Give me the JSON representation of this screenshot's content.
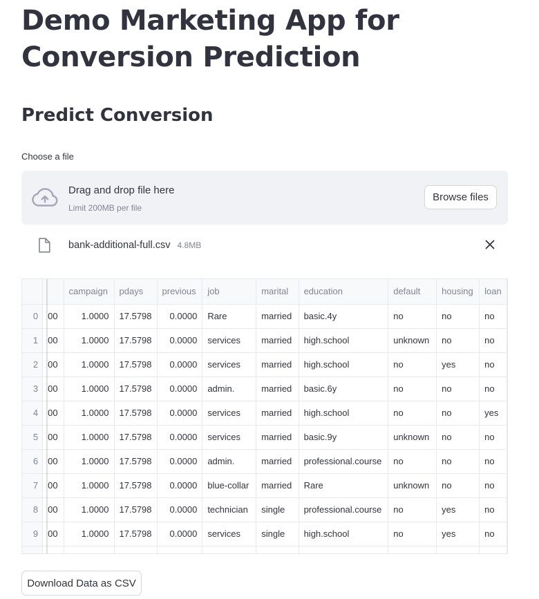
{
  "page": {
    "title": "Demo Marketing App for Conversion Prediction",
    "section_title": "Predict Conversion"
  },
  "uploader": {
    "label": "Choose a file",
    "drag_text": "Drag and drop file here",
    "limit_text": "Limit 200MB per file",
    "browse_label": "Browse files",
    "icon": "cloud-upload-icon"
  },
  "uploaded_file": {
    "name": "bank-additional-full.csv",
    "size": "4.8MB",
    "icon": "file-icon",
    "remove_icon": "close-icon"
  },
  "dataframe": {
    "columns": [
      "campaign",
      "pdays",
      "previous",
      "job",
      "marital",
      "education",
      "default",
      "housing",
      "loan"
    ],
    "rows": [
      {
        "index": "0",
        "cut": "00",
        "cells": [
          "1.0000",
          "17.5798",
          "0.0000",
          "Rare",
          "married",
          "basic.4y",
          "no",
          "no",
          "no"
        ]
      },
      {
        "index": "1",
        "cut": "00",
        "cells": [
          "1.0000",
          "17.5798",
          "0.0000",
          "services",
          "married",
          "high.school",
          "unknown",
          "no",
          "no"
        ]
      },
      {
        "index": "2",
        "cut": "00",
        "cells": [
          "1.0000",
          "17.5798",
          "0.0000",
          "services",
          "married",
          "high.school",
          "no",
          "yes",
          "no"
        ]
      },
      {
        "index": "3",
        "cut": "00",
        "cells": [
          "1.0000",
          "17.5798",
          "0.0000",
          "admin.",
          "married",
          "basic.6y",
          "no",
          "no",
          "no"
        ]
      },
      {
        "index": "4",
        "cut": "00",
        "cells": [
          "1.0000",
          "17.5798",
          "0.0000",
          "services",
          "married",
          "high.school",
          "no",
          "no",
          "yes"
        ]
      },
      {
        "index": "5",
        "cut": "00",
        "cells": [
          "1.0000",
          "17.5798",
          "0.0000",
          "services",
          "married",
          "basic.9y",
          "unknown",
          "no",
          "no"
        ]
      },
      {
        "index": "6",
        "cut": "00",
        "cells": [
          "1.0000",
          "17.5798",
          "0.0000",
          "admin.",
          "married",
          "professional.course",
          "no",
          "no",
          "no"
        ]
      },
      {
        "index": "7",
        "cut": "00",
        "cells": [
          "1.0000",
          "17.5798",
          "0.0000",
          "blue-collar",
          "married",
          "Rare",
          "unknown",
          "no",
          "no"
        ]
      },
      {
        "index": "8",
        "cut": "00",
        "cells": [
          "1.0000",
          "17.5798",
          "0.0000",
          "technician",
          "single",
          "professional.course",
          "no",
          "yes",
          "no"
        ]
      },
      {
        "index": "9",
        "cut": "00",
        "cells": [
          "1.0000",
          "17.5798",
          "0.0000",
          "services",
          "single",
          "high.school",
          "no",
          "yes",
          "no"
        ]
      }
    ]
  },
  "download": {
    "label": "Download Data as CSV"
  }
}
